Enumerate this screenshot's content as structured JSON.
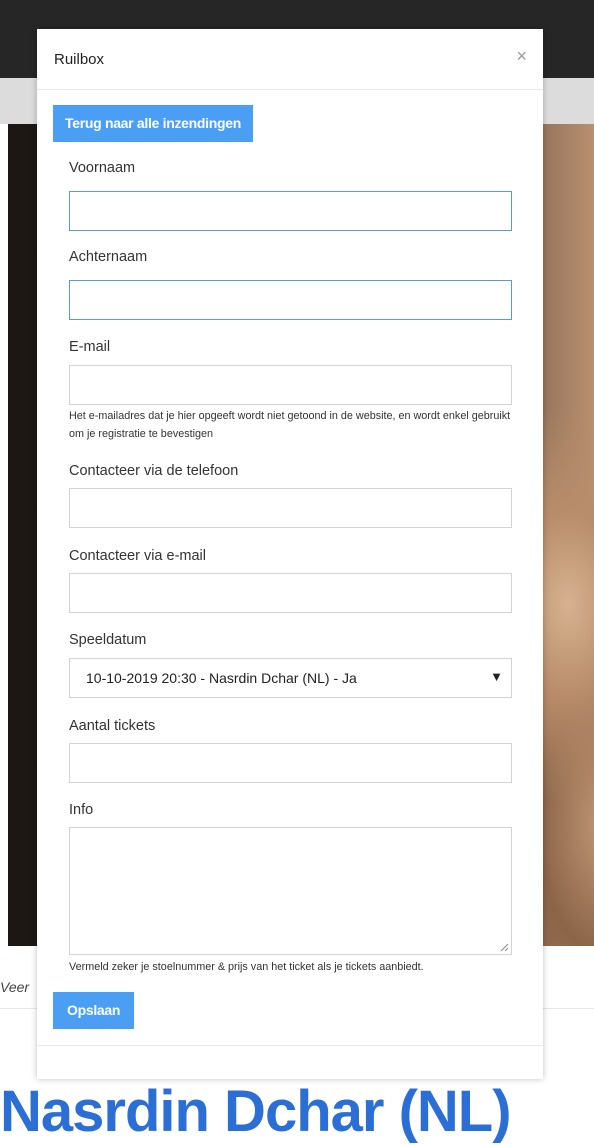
{
  "background": {
    "side_text": "Veer",
    "big_title": "Nasrdin Dchar (NL)"
  },
  "modal": {
    "title": "Ruilbox",
    "close_symbol": "×",
    "back_button_label": "Terug naar alle inzendingen",
    "fields": {
      "voornaam": {
        "label": "Voornaam",
        "value": ""
      },
      "achternaam": {
        "label": "Achternaam",
        "value": ""
      },
      "email": {
        "label": "E-mail",
        "value": "",
        "help": "Het e-mailadres dat je hier opgeeft wordt niet getoond in de website, en wordt enkel gebruikt om je registratie te bevestigen"
      },
      "contact_phone": {
        "label": "Contacteer via de telefoon",
        "value": ""
      },
      "contact_email": {
        "label": "Contacteer via e-mail",
        "value": ""
      },
      "speeldatum": {
        "label": "Speeldatum",
        "selected": "10-10-2019 20:30 - Nasrdin Dchar (NL) - Ja",
        "arrow": "▼"
      },
      "aantal_tickets": {
        "label": "Aantal tickets",
        "value": ""
      },
      "info": {
        "label": "Info",
        "value": "",
        "help": "Vermeld zeker je stoelnummer & prijs van het ticket als je tickets aanbiedt."
      }
    },
    "save_button_label": "Opslaan"
  },
  "colors": {
    "accent": "#4a9ff5",
    "focus_border": "#5b9bd5",
    "title_blue": "#2b6fd6"
  }
}
